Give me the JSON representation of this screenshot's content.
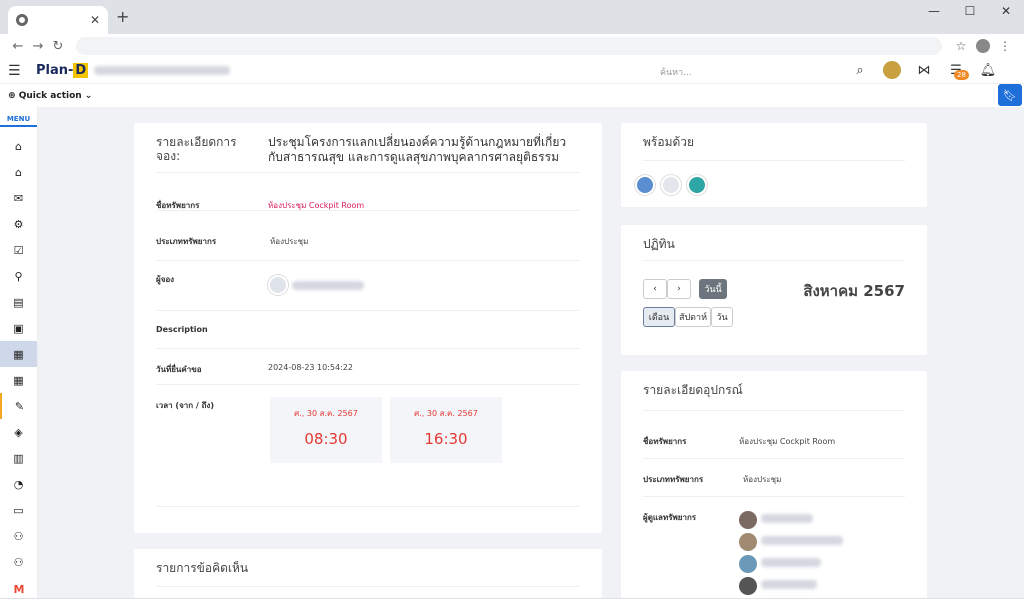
{
  "browser": {
    "new_tab": "+",
    "win_min": "—",
    "win_max": "☐",
    "win_close": "✕"
  },
  "app": {
    "logo_main": "Plan-",
    "logo_d": "D",
    "search_placeholder": "ค้นหา...",
    "notification_count": "28",
    "quick_action": "Quick action"
  },
  "sidebar": {
    "menu_label": "MENU",
    "icons": [
      "home-icon",
      "home-icon",
      "mail-icon",
      "user-gear-icon",
      "checklist-icon",
      "person-pin-icon",
      "document-icon",
      "cash-icon",
      "calendar-star-icon",
      "calendar-icon",
      "edit-note-icon",
      "layers-icon",
      "building-icon",
      "chart-icon",
      "ticket-icon",
      "user-clock-icon",
      "user-icon"
    ]
  },
  "booking": {
    "title_label": "รายละเอียดการจอง:",
    "title_value": "ประชุมโครงการแลกเปลี่ยนองค์ความรู้ด้านกฎหมายที่เกี่ยวกับสาธารณสุข และการดูแลสุขภาพบุคลากรศาลยุติธรรม",
    "resource_label": "ชื่อทรัพยากร",
    "resource_value": "ห้องประชุม Cockpit Room",
    "type_label": "ประเภททรัพยากร",
    "type_value": "ห้องประชุม",
    "booker_label": "ผู้จอง",
    "description_label": "Description",
    "request_date_label": "วันที่ยื่นคำขอ",
    "request_date_value": "2024-08-23 10:54:22",
    "time_label": "เวลา (จาก / ถึง)",
    "from_date": "ศ., 30 ส.ค. 2567",
    "from_time": "08:30",
    "to_date": "ศ., 30 ส.ค. 2567",
    "to_time": "16:30"
  },
  "comments": {
    "title": "รายการข้อคิดเห็น"
  },
  "participants": {
    "title": "พร้อมด้วย"
  },
  "calendar": {
    "title": "ปฏิทิน",
    "prev": "‹",
    "next": "›",
    "today": "วันนี้",
    "month_title": "สิงหาคม 2567",
    "view_month": "เดือน",
    "view_week": "สัปดาห์",
    "view_day": "วัน"
  },
  "equipment": {
    "title": "รายละเอียดอุปกรณ์",
    "resource_label": "ชื่อทรัพยากร",
    "resource_value": "ห้องประชุม Cockpit Room",
    "type_label": "ประเภททรัพยากร",
    "type_value": "ห้องประชุม",
    "manager_label": "ผู้ดูแลทรัพยากร"
  },
  "colors": {
    "accent": "#1e6fd9",
    "time_red": "#e53935",
    "link_pink": "#d81b60",
    "badge_orange": "#f08a24"
  }
}
